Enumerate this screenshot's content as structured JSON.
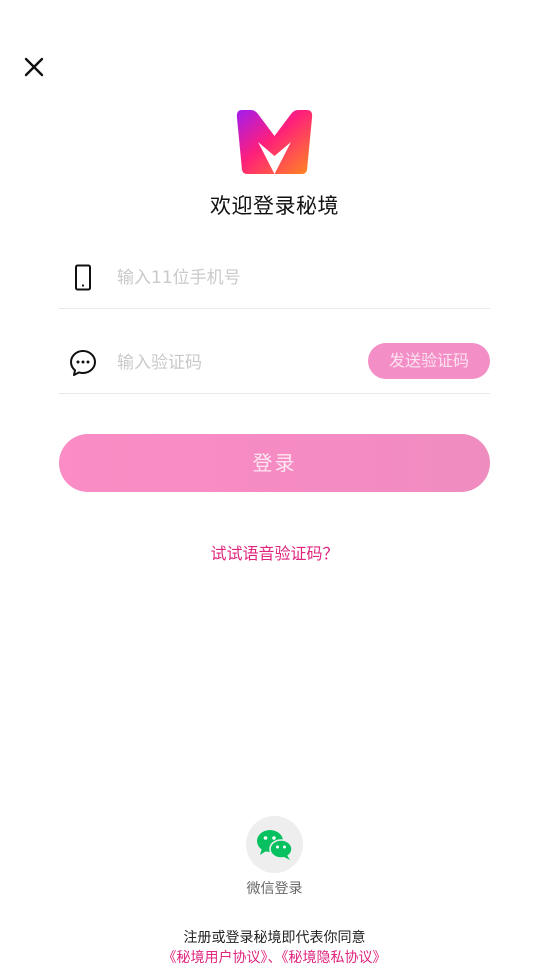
{
  "icons": {
    "close": "close-icon",
    "logo": "app-logo-icon",
    "phone": "phone-icon",
    "message": "message-icon",
    "wechat": "wechat-icon"
  },
  "colors": {
    "accent": "#e0257d",
    "button_pink": "#f48ec6",
    "wechat_green": "#07c160"
  },
  "header": {
    "welcome_title": "欢迎登录秘境"
  },
  "form": {
    "phone_placeholder": "输入11位手机号",
    "code_placeholder": "输入验证码",
    "send_code_label": "发送验证码",
    "login_label": "登录"
  },
  "voice_link": "试试语音验证码？",
  "third_party": {
    "wechat_label": "微信登录"
  },
  "agreement": {
    "prefix": "注册或登录秘境即代表你同意",
    "user_agreement": "《秘境用户协议》",
    "separator": "、",
    "privacy_agreement": "《秘境隐私协议》"
  }
}
